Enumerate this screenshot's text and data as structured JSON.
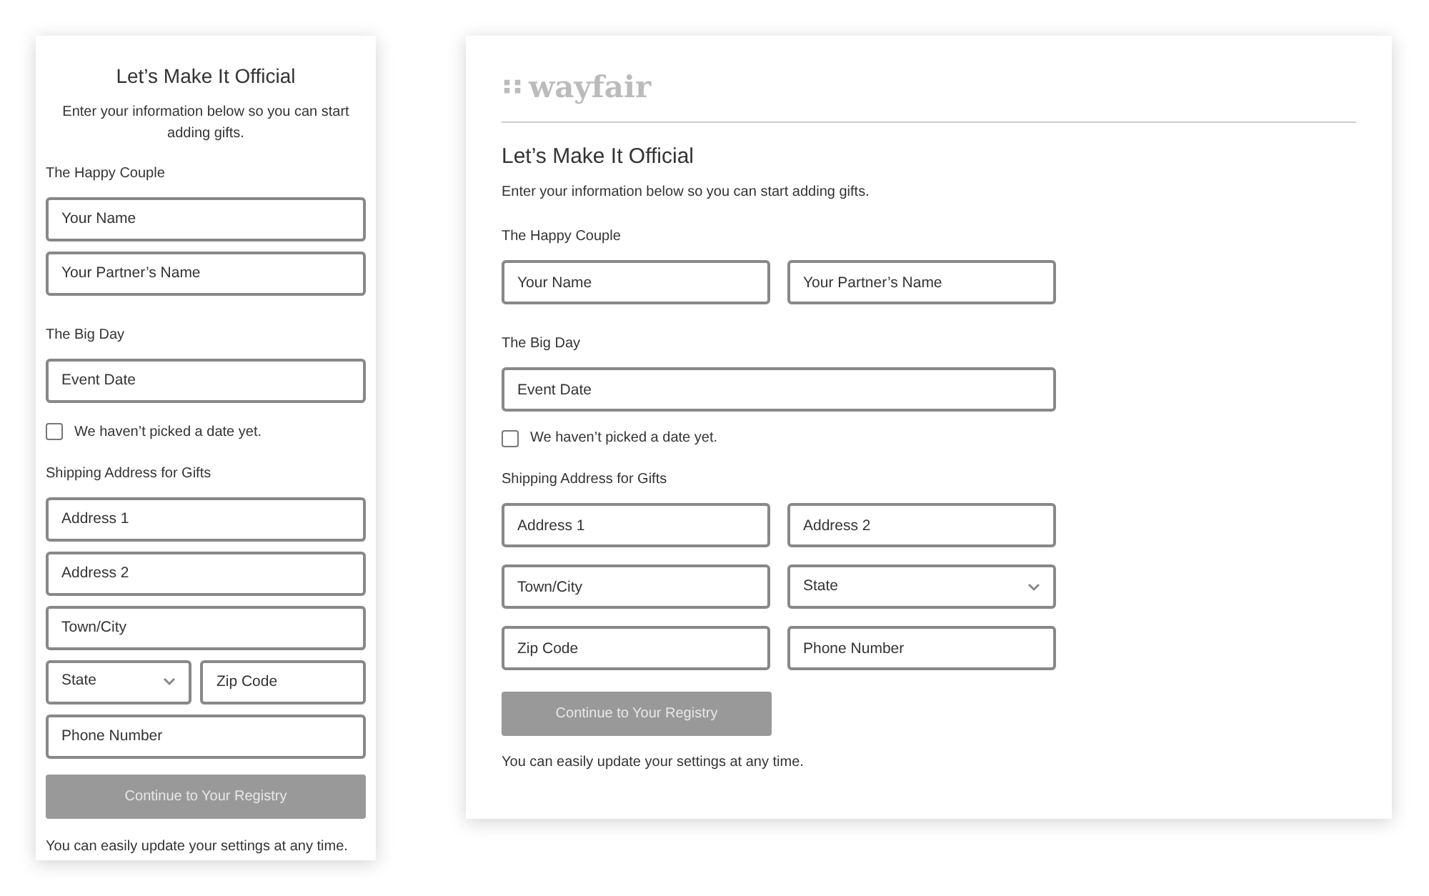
{
  "mobile": {
    "title": "Let’s Make It Official",
    "intro": "Enter your information below so you can start adding gifts.",
    "sections": [
      {
        "heading": "The Happy Couple",
        "rows": [
          [
            {
              "kind": "input",
              "placeholder": "Your Name"
            }
          ],
          [
            {
              "kind": "input",
              "placeholder": "Your Partner’s Name"
            }
          ]
        ]
      },
      {
        "heading": "The Big Day",
        "rows": [
          [
            {
              "kind": "input",
              "placeholder": "Event Date"
            }
          ]
        ],
        "checkbox": {
          "label": "We haven’t picked a date yet.",
          "checked": false
        }
      },
      {
        "heading": "Shipping Address for Gifts",
        "rows": [
          [
            {
              "kind": "input",
              "placeholder": "Address 1"
            }
          ],
          [
            {
              "kind": "input",
              "placeholder": "Address 2"
            }
          ],
          [
            {
              "kind": "input",
              "placeholder": "Town/City"
            }
          ],
          [
            {
              "kind": "select",
              "placeholder": "State"
            },
            {
              "kind": "input",
              "placeholder": "Zip Code"
            }
          ],
          [
            {
              "kind": "input",
              "placeholder": "Phone Number"
            }
          ]
        ]
      }
    ],
    "button": {
      "label": "Continue to Your Registry",
      "disabled": true
    },
    "note": "You can easily update your settings at any time."
  },
  "desktop": {
    "logo": "wayfair",
    "title": "Let’s Make It Official",
    "intro": "Enter your information below so you can start adding gifts.",
    "sections": [
      {
        "heading": "The Happy Couple",
        "rows": [
          [
            {
              "kind": "input",
              "placeholder": "Your Name"
            },
            {
              "kind": "input",
              "placeholder": "Your Partner’s Name"
            }
          ]
        ]
      },
      {
        "heading": "The Big Day",
        "rows": [
          [
            {
              "kind": "input",
              "placeholder": "Event Date"
            }
          ]
        ],
        "checkbox": {
          "label": "We haven’t picked a date yet.",
          "checked": false
        }
      },
      {
        "heading": "Shipping Address for Gifts",
        "rows": [
          [
            {
              "kind": "input",
              "placeholder": "Address 1"
            },
            {
              "kind": "input",
              "placeholder": "Address 2"
            }
          ],
          [
            {
              "kind": "input",
              "placeholder": "Town/City"
            },
            {
              "kind": "select",
              "placeholder": "State"
            }
          ],
          [
            {
              "kind": "input",
              "placeholder": "Zip Code"
            },
            {
              "kind": "input",
              "placeholder": "Phone Number"
            }
          ]
        ]
      }
    ],
    "button": {
      "label": "Continue to Your Registry",
      "disabled": true
    },
    "note": "You can easily update your settings at any time."
  }
}
